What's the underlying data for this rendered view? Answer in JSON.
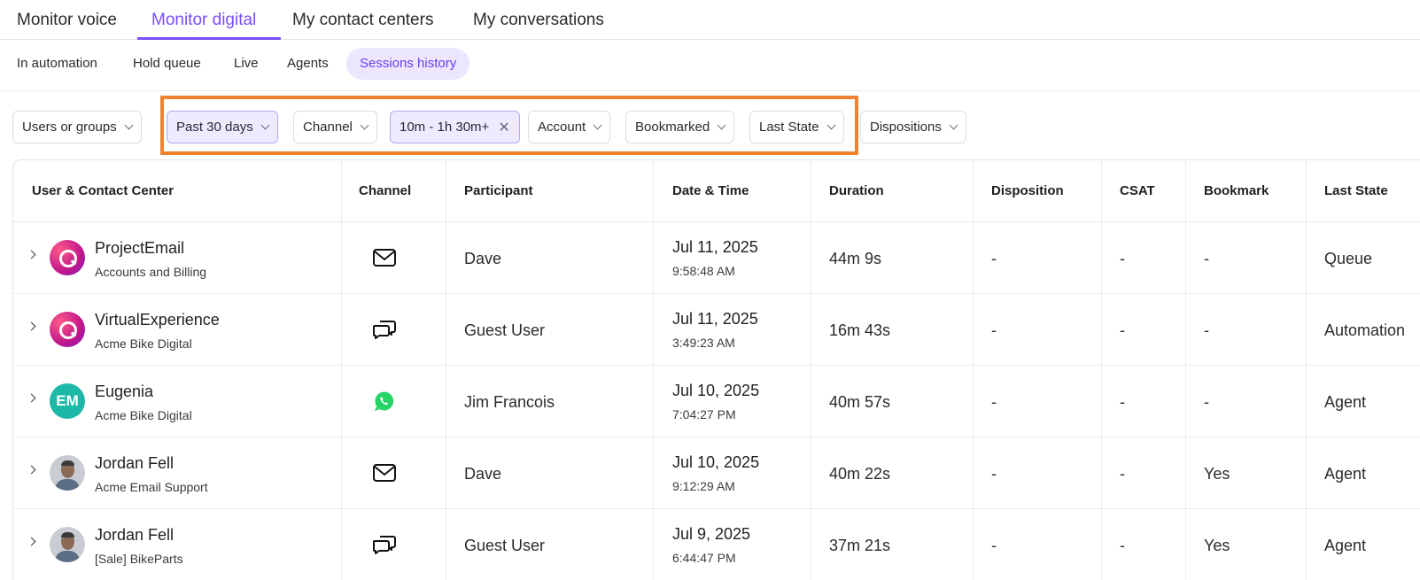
{
  "top_tabs": [
    {
      "label": "Monitor voice",
      "active": false
    },
    {
      "label": "Monitor digital",
      "active": true
    },
    {
      "label": "My contact centers",
      "active": false
    },
    {
      "label": "My conversations",
      "active": false
    }
  ],
  "sub_tabs": [
    {
      "label": "In automation",
      "active": false
    },
    {
      "label": "Hold queue",
      "active": false
    },
    {
      "label": "Live",
      "active": false
    },
    {
      "label": "Agents",
      "active": false
    },
    {
      "label": "Sessions history",
      "active": true
    }
  ],
  "filters": [
    {
      "label": "Users or groups",
      "selected": false
    },
    {
      "label": "Past 30 days",
      "selected": true
    },
    {
      "label": "Channel",
      "selected": false
    },
    {
      "label": "10m - 1h 30m+",
      "selected": true,
      "clearable": true
    },
    {
      "label": "Account",
      "selected": false
    },
    {
      "label": "Bookmarked",
      "selected": false
    },
    {
      "label": "Last State",
      "selected": false
    },
    {
      "label": "Dispositions",
      "selected": false
    }
  ],
  "colors": {
    "accent": "#7c4dff",
    "highlight": "#f0822f",
    "whatsapp": "#25d366"
  },
  "table": {
    "headers": [
      "User & Contact Center",
      "Channel",
      "Participant",
      "Date & Time",
      "Duration",
      "Disposition",
      "CSAT",
      "Bookmark",
      "Last State"
    ],
    "rows": [
      {
        "name": "ProjectEmail",
        "center": "Accounts and Billing",
        "avatar": "brand-logo",
        "channel": "email-icon",
        "participant": "Dave",
        "date": "Jul 11, 2025",
        "time": "9:58:48 AM",
        "duration": "44m 9s",
        "disposition": "-",
        "csat": "-",
        "bookmark": "-",
        "last_state": "Queue"
      },
      {
        "name": "VirtualExperience",
        "center": "Acme Bike Digital",
        "avatar": "brand-logo",
        "channel": "chat-icon",
        "participant": "Guest User",
        "date": "Jul 11, 2025",
        "time": "3:49:23 AM",
        "duration": "16m 43s",
        "disposition": "-",
        "csat": "-",
        "bookmark": "-",
        "last_state": "Automation"
      },
      {
        "name": "Eugenia",
        "center": "Acme Bike Digital",
        "avatar": "initials",
        "initials": "EM",
        "channel": "whatsapp-icon",
        "participant": "Jim Francois",
        "date": "Jul 10, 2025",
        "time": "7:04:27 PM",
        "duration": "40m 57s",
        "disposition": "-",
        "csat": "-",
        "bookmark": "-",
        "last_state": "Agent"
      },
      {
        "name": "Jordan Fell",
        "center": "Acme Email Support",
        "avatar": "photo",
        "channel": "email-icon",
        "participant": "Dave",
        "date": "Jul 10, 2025",
        "time": "9:12:29 AM",
        "duration": "40m 22s",
        "disposition": "-",
        "csat": "-",
        "bookmark": "Yes",
        "last_state": "Agent"
      },
      {
        "name": "Jordan Fell",
        "center": "[Sale] BikeParts",
        "avatar": "photo",
        "channel": "chat-icon",
        "participant": "Guest User",
        "date": "Jul 9, 2025",
        "time": "6:44:47 PM",
        "duration": "37m 21s",
        "disposition": "-",
        "csat": "-",
        "bookmark": "Yes",
        "last_state": "Agent"
      }
    ]
  }
}
